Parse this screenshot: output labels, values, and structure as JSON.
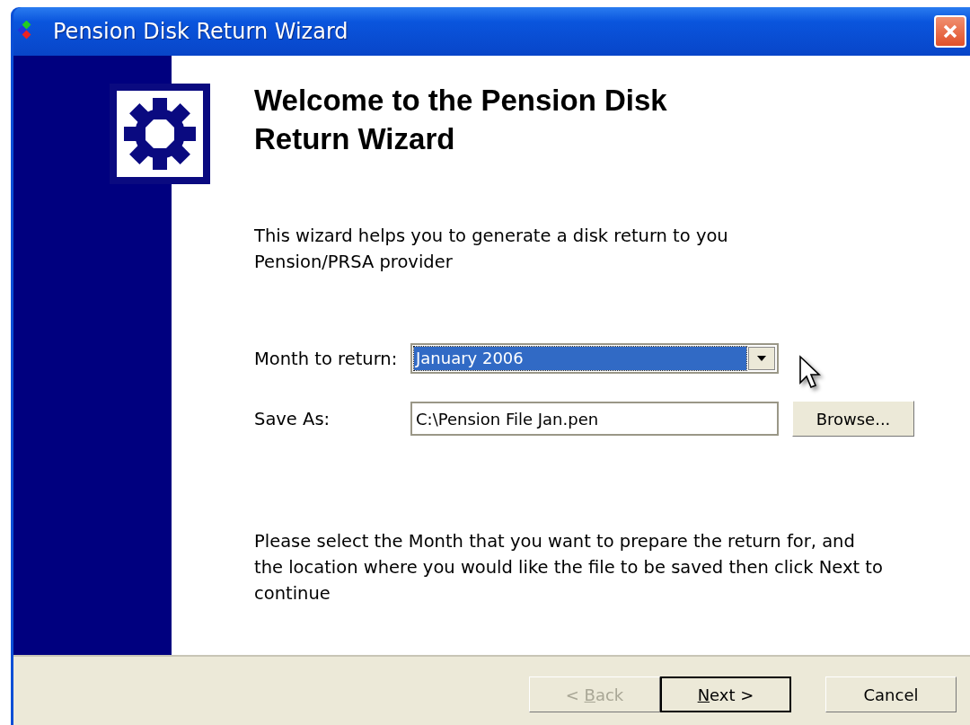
{
  "window": {
    "title": "Pension Disk Return Wizard"
  },
  "heading": "Welcome to the Pension Disk Return Wizard",
  "intro": "This wizard helps you to generate a disk return to you Pension/PRSA provider",
  "form": {
    "month": {
      "label": "Month to return:",
      "value": "January 2006",
      "selected": true
    },
    "save_as": {
      "label": "Save As:",
      "value": "C:\\Pension File Jan.pen"
    },
    "browse": "Browse..."
  },
  "instructions": "Please select the Month that you want to prepare the return for, and the location where you would like the file to be saved then click Next to continue",
  "buttons": [
    {
      "kind": "back",
      "pre": "< ",
      "key": "B",
      "rest": "ack",
      "disabled": true,
      "default": false
    },
    {
      "kind": "next",
      "key": "N",
      "rest": "ext >",
      "disabled": false,
      "default": true
    },
    {
      "kind": "cancel",
      "rest": "Cancel",
      "disabled": false,
      "default": false
    }
  ]
}
